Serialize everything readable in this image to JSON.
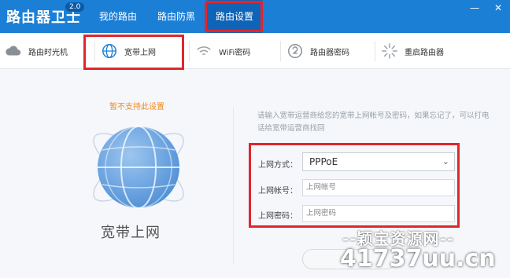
{
  "app": {
    "title": "路由器卫士",
    "version": "2.0"
  },
  "nav": {
    "tabs": [
      {
        "label": "我的路由"
      },
      {
        "label": "路由防黑"
      },
      {
        "label": "路由设置",
        "active": true
      }
    ]
  },
  "window_controls": {
    "minimize": "—",
    "close": "✕"
  },
  "subnav": {
    "items": [
      {
        "label": "路由时光机",
        "icon": "cloud-icon"
      },
      {
        "label": "宽带上网",
        "icon": "globe-icon",
        "active": true
      },
      {
        "label": "WiFi密码",
        "icon": "wifi-icon"
      },
      {
        "label": "路由器密码",
        "icon": "key-icon"
      },
      {
        "label": "重启路由器",
        "icon": "restart-icon"
      }
    ]
  },
  "left_panel": {
    "notice": "暂不支持此设置",
    "caption": "宽带上网",
    "illustration": "globe-icon"
  },
  "form": {
    "hint": "请输入宽带运营商给您的宽带上网帐号及密码，如果忘记了，可以打电话给宽带运营商找回",
    "mode_label": "上网方式：",
    "mode_value": "PPPoE",
    "account_label": "上网帐号：",
    "account_placeholder": "上网帐号",
    "password_label": "上网密码：",
    "password_placeholder": "上网密码"
  },
  "watermark": {
    "line1": "--颖宝资源网--",
    "line2": "41737uu.cn"
  },
  "colors": {
    "brand": "#1c7fd6",
    "highlight": "#e0262d",
    "notice": "#f08a1e"
  }
}
